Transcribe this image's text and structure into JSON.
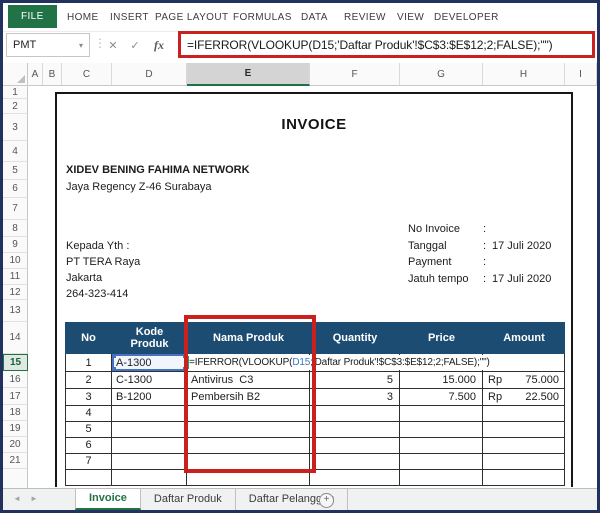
{
  "ribbon": {
    "tabs": [
      {
        "label": "FILE",
        "active": true
      },
      {
        "label": "HOME",
        "active": false
      },
      {
        "label": "INSERT",
        "active": false
      },
      {
        "label": "PAGE LAYOUT",
        "active": false
      },
      {
        "label": "FORMULAS",
        "active": false
      },
      {
        "label": "DATA",
        "active": false
      },
      {
        "label": "REVIEW",
        "active": false
      },
      {
        "label": "VIEW",
        "active": false
      },
      {
        "label": "DEVELOPER",
        "active": false
      }
    ]
  },
  "formula_bar": {
    "name_box": "PMT",
    "cancel_glyph": "✕",
    "enter_glyph": "✓",
    "fx_glyph": "fx",
    "formula": "=IFERROR(VLOOKUP(D15;'Daftar Produk'!$C$3:$E$12;2;FALSE);\"\")"
  },
  "grid": {
    "column_letters": [
      "A",
      "B",
      "C",
      "D",
      "E",
      "F",
      "G",
      "H",
      "I"
    ],
    "active_column": "E",
    "row_numbers": [
      1,
      2,
      3,
      4,
      5,
      6,
      7,
      8,
      9,
      10,
      11,
      12,
      13,
      14,
      15,
      16,
      17,
      18,
      19,
      20,
      21
    ],
    "active_row": 15
  },
  "invoice": {
    "title": "INVOICE",
    "company_name": "XIDEV BENING FAHIMA NETWORK",
    "company_address": "Jaya Regency Z-46 Surabaya",
    "recipient": {
      "label": "Kepada Yth :",
      "name": "PT TERA Raya",
      "city": "Jakarta",
      "phone": "264-323-414"
    },
    "meta": [
      {
        "label": "No Invoice",
        "sep": ":",
        "value": ""
      },
      {
        "label": "Tanggal",
        "sep": ":",
        "value": "17 Juli 2020"
      },
      {
        "label": "Payment",
        "sep": ":",
        "value": ""
      },
      {
        "label": "Jatuh tempo",
        "sep": ":",
        "value": "17 Juli 2020"
      }
    ],
    "table": {
      "headers": [
        "No",
        "Kode Produk",
        "Nama Produk",
        "Quantity",
        "Price",
        "Amount"
      ],
      "edit_formula": {
        "pre": "=IFERROR(VLOOKUP(",
        "ref": "D15",
        "post": ";'Daftar Produk'!$C$3:$E$12;2;FALSE);\"\")"
      },
      "rows": [
        {
          "no": "1",
          "kode": "A-1300",
          "nama": "",
          "qty": "",
          "price": "",
          "rp": "",
          "amount": ""
        },
        {
          "no": "2",
          "kode": "C-1300",
          "nama": "Antivirus  C3",
          "qty": "5",
          "price": "15.000",
          "rp": "Rp",
          "amount": "75.000"
        },
        {
          "no": "3",
          "kode": "B-1200",
          "nama": "Pembersih B2",
          "qty": "3",
          "price": "7.500",
          "rp": "Rp",
          "amount": "22.500"
        },
        {
          "no": "4",
          "kode": "",
          "nama": "",
          "qty": "",
          "price": "",
          "rp": "",
          "amount": ""
        },
        {
          "no": "5",
          "kode": "",
          "nama": "",
          "qty": "",
          "price": "",
          "rp": "",
          "amount": ""
        },
        {
          "no": "6",
          "kode": "",
          "nama": "",
          "qty": "",
          "price": "",
          "rp": "",
          "amount": ""
        },
        {
          "no": "7",
          "kode": "",
          "nama": "",
          "qty": "",
          "price": "",
          "rp": "",
          "amount": ""
        },
        {
          "no": "",
          "kode": "",
          "nama": "",
          "qty": "",
          "price": "",
          "rp": "",
          "amount": ""
        }
      ]
    }
  },
  "sheet_tabs": {
    "nav_back": "◄",
    "nav_forward": "►",
    "tabs": [
      {
        "label": "Invoice",
        "active": true
      },
      {
        "label": "Daftar Produk",
        "active": false
      },
      {
        "label": "Daftar Pelanggan",
        "active": false
      }
    ],
    "new_sheet_label": "+"
  },
  "colors": {
    "excel_green": "#217346",
    "table_header_navy": "#1d4c72",
    "annotation_red": "#c9211e",
    "reference_blue": "#3f76bf",
    "frame_navy": "#22315e"
  }
}
